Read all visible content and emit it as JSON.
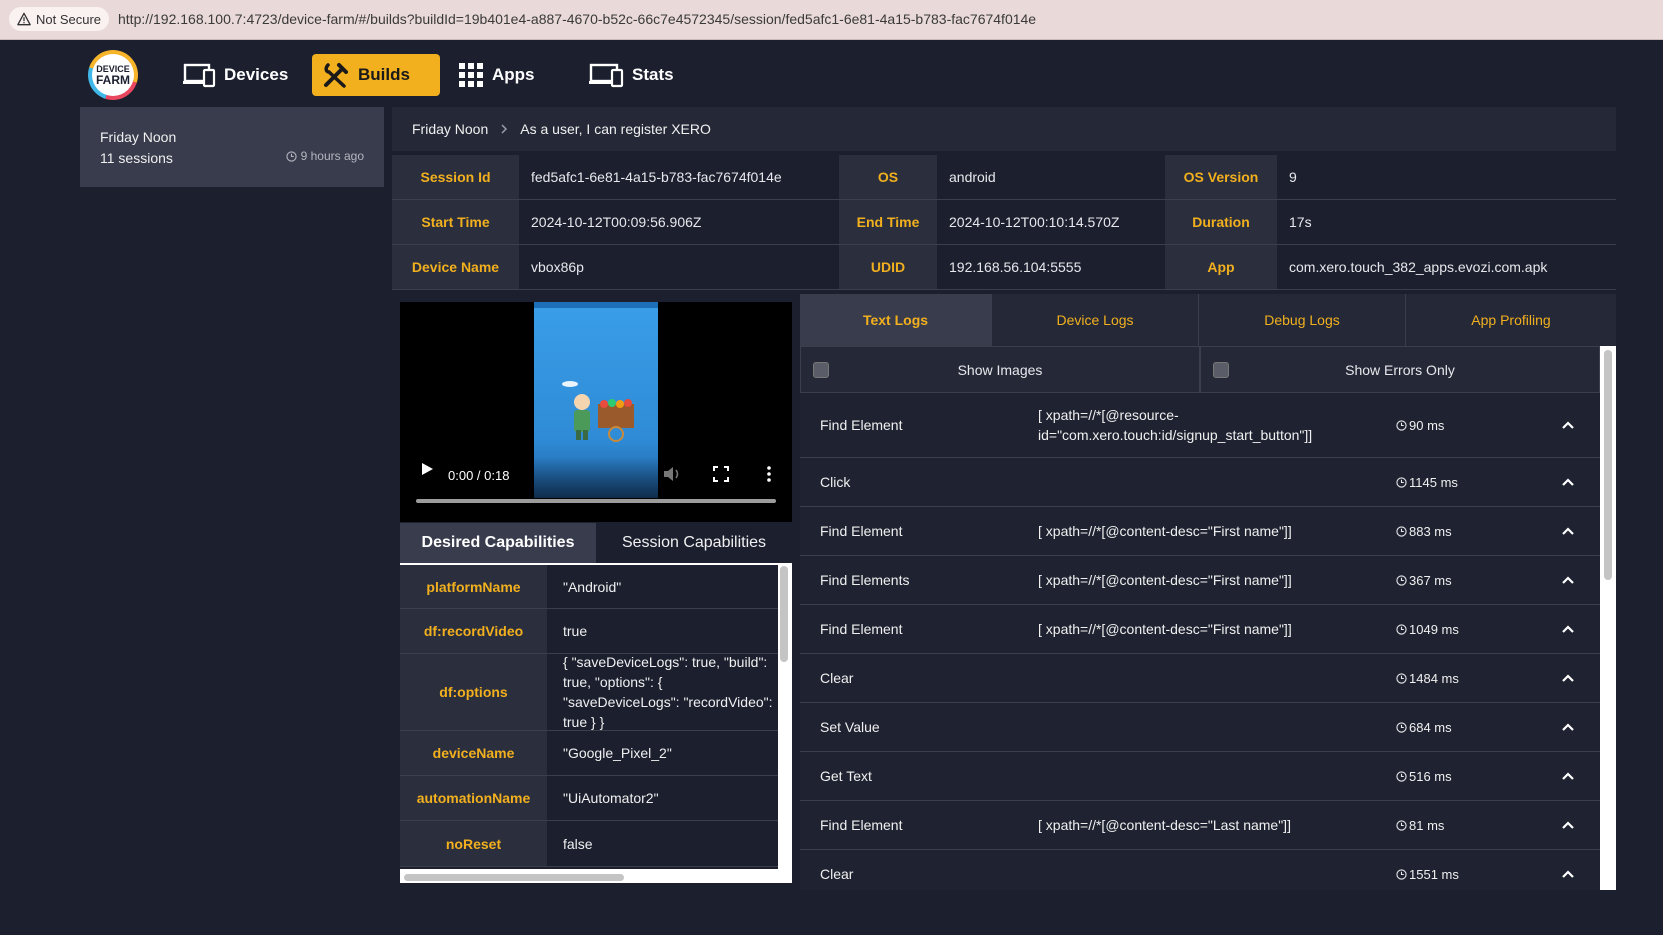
{
  "browser": {
    "security_label": "Not Secure",
    "url": "http://192.168.100.7:4723/device-farm/#/builds?buildId=19b401e4-a887-4670-b52c-66c7e4572345/session/fed5afc1-6e81-4a15-b783-fac7674f014e"
  },
  "logo": {
    "line1": "DEVICE",
    "line2": "FARM"
  },
  "nav": {
    "devices": "Devices",
    "builds": "Builds",
    "apps": "Apps",
    "stats": "Stats",
    "active": "builds",
    "accent_color": "#f2b01e"
  },
  "build": {
    "name": "Friday Noon",
    "sessions": "11 sessions",
    "time_ago": "9 hours ago"
  },
  "breadcrumb": {
    "build": "Friday Noon",
    "session": "As a user, I can register XERO"
  },
  "session_info": {
    "session_id_label": "Session Id",
    "session_id": "fed5afc1-6e81-4a15-b783-fac7674f014e",
    "os_label": "OS",
    "os": "android",
    "os_version_label": "OS Version",
    "os_version": "9",
    "start_time_label": "Start Time",
    "start_time": "2024-10-12T00:09:56.906Z",
    "end_time_label": "End Time",
    "end_time": "2024-10-12T00:10:14.570Z",
    "duration_label": "Duration",
    "duration": "17s",
    "device_name_label": "Device Name",
    "device_name": "vbox86p",
    "udid_label": "UDID",
    "udid": "192.168.56.104:5555",
    "app_label": "App",
    "app": "com.xero.touch_382_apps.evozi.com.apk"
  },
  "video": {
    "time": "0:00 / 0:18",
    "progress": 0
  },
  "capabilities": {
    "tabs": [
      "Desired Capabilities",
      "Session Capabilities"
    ],
    "active_tab": "Desired Capabilities",
    "rows": [
      {
        "key": "platformName",
        "value": "\"Android\""
      },
      {
        "key": "df:recordVideo",
        "value": "true"
      },
      {
        "key": "df:options",
        "value": "{ \"saveDeviceLogs\": true, \"build\": true, \"options\": { \"saveDeviceLogs\": \"recordVideo\": true } }"
      },
      {
        "key": "deviceName",
        "value": "\"Google_Pixel_2\""
      },
      {
        "key": "automationName",
        "value": "\"UiAutomator2\""
      },
      {
        "key": "noReset",
        "value": "false"
      }
    ]
  },
  "logs": {
    "tabs": [
      "Text Logs",
      "Device Logs",
      "Debug Logs",
      "App Profiling"
    ],
    "active_tab": "Text Logs",
    "filters": {
      "show_images": "Show Images",
      "show_errors": "Show Errors Only"
    },
    "entries": [
      {
        "command": "Find Element",
        "args": "[ xpath=//*[@resource-id=\"com.xero.touch:id/signup_start_button\"]]",
        "duration": "90 ms"
      },
      {
        "command": "Click",
        "args": "",
        "duration": "1145 ms"
      },
      {
        "command": "Find Element",
        "args": "[ xpath=//*[@content-desc=\"First name\"]]",
        "duration": "883 ms"
      },
      {
        "command": "Find Elements",
        "args": "[ xpath=//*[@content-desc=\"First name\"]]",
        "duration": "367 ms"
      },
      {
        "command": "Find Element",
        "args": "[ xpath=//*[@content-desc=\"First name\"]]",
        "duration": "1049 ms"
      },
      {
        "command": "Clear",
        "args": "",
        "duration": "1484 ms"
      },
      {
        "command": "Set Value",
        "args": "",
        "duration": "684 ms"
      },
      {
        "command": "Get Text",
        "args": "",
        "duration": "516 ms"
      },
      {
        "command": "Find Element",
        "args": "[ xpath=//*[@content-desc=\"Last name\"]]",
        "duration": "81 ms"
      },
      {
        "command": "Clear",
        "args": "",
        "duration": "1551 ms"
      }
    ]
  }
}
